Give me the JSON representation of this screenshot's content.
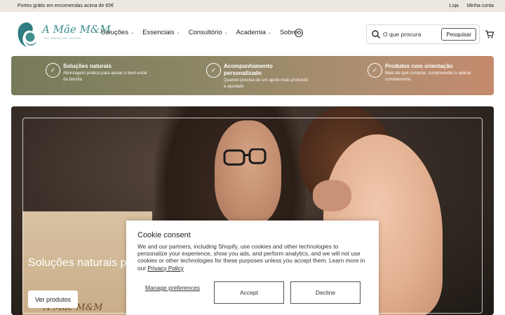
{
  "topbar": {
    "promo": "Portes grátis em encomendas acima de 65€",
    "links": [
      "Loja",
      "Minha conta"
    ]
  },
  "header": {
    "logo_text": "A Mãe M&M",
    "logo_sub": "THE WIMDELING CENTER",
    "nav": [
      "Soluções",
      "Essenciais",
      "Consultório",
      "Academia",
      "Sobre"
    ],
    "search": {
      "placeholder": "O que procura",
      "button": "Pesquisar"
    },
    "icons": {
      "account": "account-icon",
      "search": "search-icon",
      "cart": "cart-icon"
    }
  },
  "features": [
    {
      "title": "Soluções naturais",
      "desc": "Abordagem prática para apoiar o bem-estar da família"
    },
    {
      "title": "Acompanhamento personalizado",
      "desc": "Quando precisa de um apoio mais profundo e ajustado"
    },
    {
      "title": "Produtos com orientação",
      "desc": "Mais do que comprar, compreender e aplicar corretamente"
    }
  ],
  "hero": {
    "title": "Soluções naturais para a família",
    "button": "Ver produtos",
    "sign_text": "A Mãe M&M"
  },
  "cookie": {
    "title": "Cookie consent",
    "text": "We and our partners, including Shopify, use cookies and other technologies to personalize your experience, show you ads, and perform analytics, and we will not use cookies or other technologies for these purposes unless you accept them. Learn more in our",
    "link": "Privacy Policy",
    "manage": "Manage preferences",
    "accept": "Accept",
    "decline": "Decline"
  },
  "colors": {
    "topbar_bg": "#ece8df",
    "brand_teal": "#3f8f8f",
    "feature_start": "#777a5a",
    "feature_end": "#c58a6d"
  }
}
